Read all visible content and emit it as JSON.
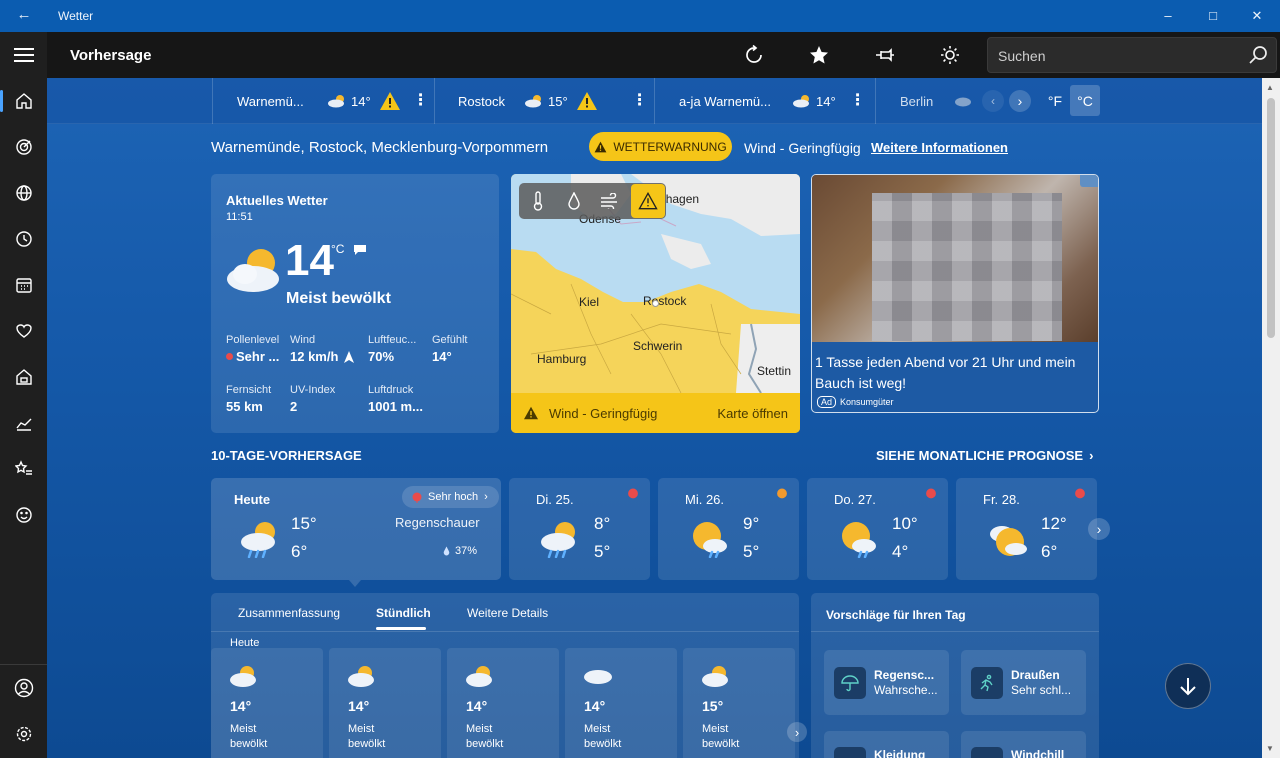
{
  "titlebar": {
    "title": "Wetter"
  },
  "topbar": {
    "title": "Vorhersage",
    "search_placeholder": "Suchen"
  },
  "locations": [
    {
      "name": "Warnemü...",
      "temp": "14°"
    },
    {
      "name": "Rostock",
      "temp": "15°"
    },
    {
      "name": "a-ja Warnemü...",
      "temp": "14°"
    },
    {
      "name": "Berlin",
      "temp": ""
    }
  ],
  "units": {
    "f": "°F",
    "c": "°C"
  },
  "header": {
    "place": "Warnemünde, Rostock, Mecklenburg-Vorpommern",
    "warning": "WETTERWARNUNG",
    "warning_detail": "Wind - Geringfügig",
    "more_info": "Weitere Informationen"
  },
  "current": {
    "title": "Aktuelles Wetter",
    "time": "11:51",
    "temp": "14",
    "unit": "°C",
    "condition": "Meist bewölkt",
    "details": [
      {
        "label": "Pollenlevel",
        "value": "Sehr ..."
      },
      {
        "label": "Wind",
        "value": "12 km/h"
      },
      {
        "label": "Luftfeuc...",
        "value": "70%"
      },
      {
        "label": "Gefühlt",
        "value": "14°"
      },
      {
        "label": "Fernsicht",
        "value": "55 km"
      },
      {
        "label": "UV-Index",
        "value": "2"
      },
      {
        "label": "Luftdruck",
        "value": "1001 m..."
      }
    ]
  },
  "map": {
    "cities": [
      "Odense",
      "Kopenhagen",
      "Kiel",
      "Rostock",
      "Hamburg",
      "Schwerin",
      "Stettin"
    ],
    "alert": "Wind - Geringfügig",
    "open": "Karte öffnen"
  },
  "ad": {
    "text": "1 Tasse jeden Abend vor 21 Uhr und mein Bauch ist weg!",
    "badge": "Ad",
    "source": "Konsumgüter"
  },
  "forecast": {
    "title": "10-TAGE-VORHERSAGE",
    "monthly": "SIEHE MONATLICHE PROGNOSE",
    "today": {
      "label": "Heute",
      "pollen": "Sehr hoch",
      "high": "15°",
      "low": "6°",
      "condition": "Regenschauer",
      "precip": "37%"
    },
    "days": [
      {
        "label": "Di. 25.",
        "high": "8°",
        "low": "5°"
      },
      {
        "label": "Mi. 26.",
        "high": "9°",
        "low": "5°"
      },
      {
        "label": "Do. 27.",
        "high": "10°",
        "low": "4°"
      },
      {
        "label": "Fr. 28.",
        "high": "12°",
        "low": "6°"
      }
    ]
  },
  "tabs": [
    "Zusammenfassung",
    "Stündlich",
    "Weitere Details"
  ],
  "hourly": {
    "day": "Heute",
    "items": [
      {
        "temp": "14°",
        "cond1": "Meist",
        "cond2": "bewölkt"
      },
      {
        "temp": "14°",
        "cond1": "Meist",
        "cond2": "bewölkt"
      },
      {
        "temp": "14°",
        "cond1": "Meist",
        "cond2": "bewölkt"
      },
      {
        "temp": "14°",
        "cond1": "Meist",
        "cond2": "bewölkt"
      },
      {
        "temp": "15°",
        "cond1": "Meist",
        "cond2": "bewölkt"
      }
    ]
  },
  "suggestions": {
    "title": "Vorschläge für Ihren Tag",
    "items": [
      {
        "title": "Regensc...",
        "sub": "Wahrsche..."
      },
      {
        "title": "Draußen",
        "sub": "Sehr schl..."
      },
      {
        "title": "Kleidung",
        "sub": ""
      },
      {
        "title": "Windchill",
        "sub": ""
      }
    ]
  }
}
